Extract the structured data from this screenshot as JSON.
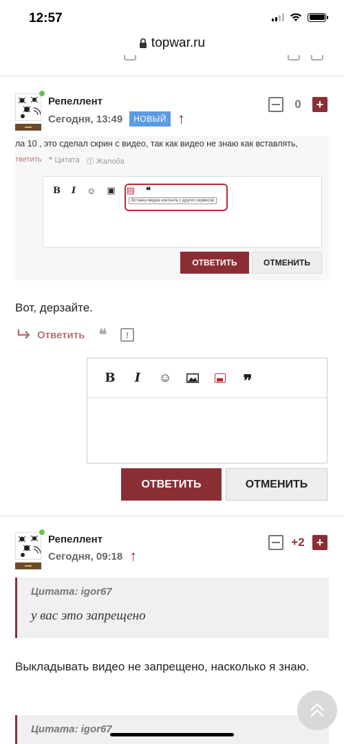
{
  "status": {
    "time": "12:57"
  },
  "browser": {
    "url": "topwar.ru"
  },
  "comment1": {
    "author": "Репеллент",
    "time": "Сегодня, 13:49",
    "badge": "НОВЫЙ",
    "rating": "0",
    "embed": {
      "text": "ла 10 , это сделал скрин с видео, так как видео не знаю как вставлять,",
      "actions": [
        "тветить",
        "Цитата",
        "Жалоба"
      ],
      "tooltip": "Вставка медиа контента с других сервисов",
      "reply_button": "ОТВЕТИТЬ",
      "cancel_button": "ОТМЕНИТЬ"
    },
    "text": "Вот, дерзайте.",
    "reply_label": "Ответить"
  },
  "editor": {
    "reply_button": "ОТВЕТИТЬ",
    "cancel_button": "ОТМЕНИТЬ"
  },
  "comment2": {
    "author": "Репеллент",
    "time": "Сегодня, 09:18",
    "rating": "+2",
    "quote_head": "Цитата: igor67",
    "quote_text": "у вас это запрещено",
    "text": "Выкладывать видео не запрещено, насколько я знаю.",
    "quote2_head": "Цитата: igor67"
  },
  "colors": {
    "brand": "#8b2e33",
    "badge": "#5b9be6",
    "online": "#6cc04a"
  }
}
